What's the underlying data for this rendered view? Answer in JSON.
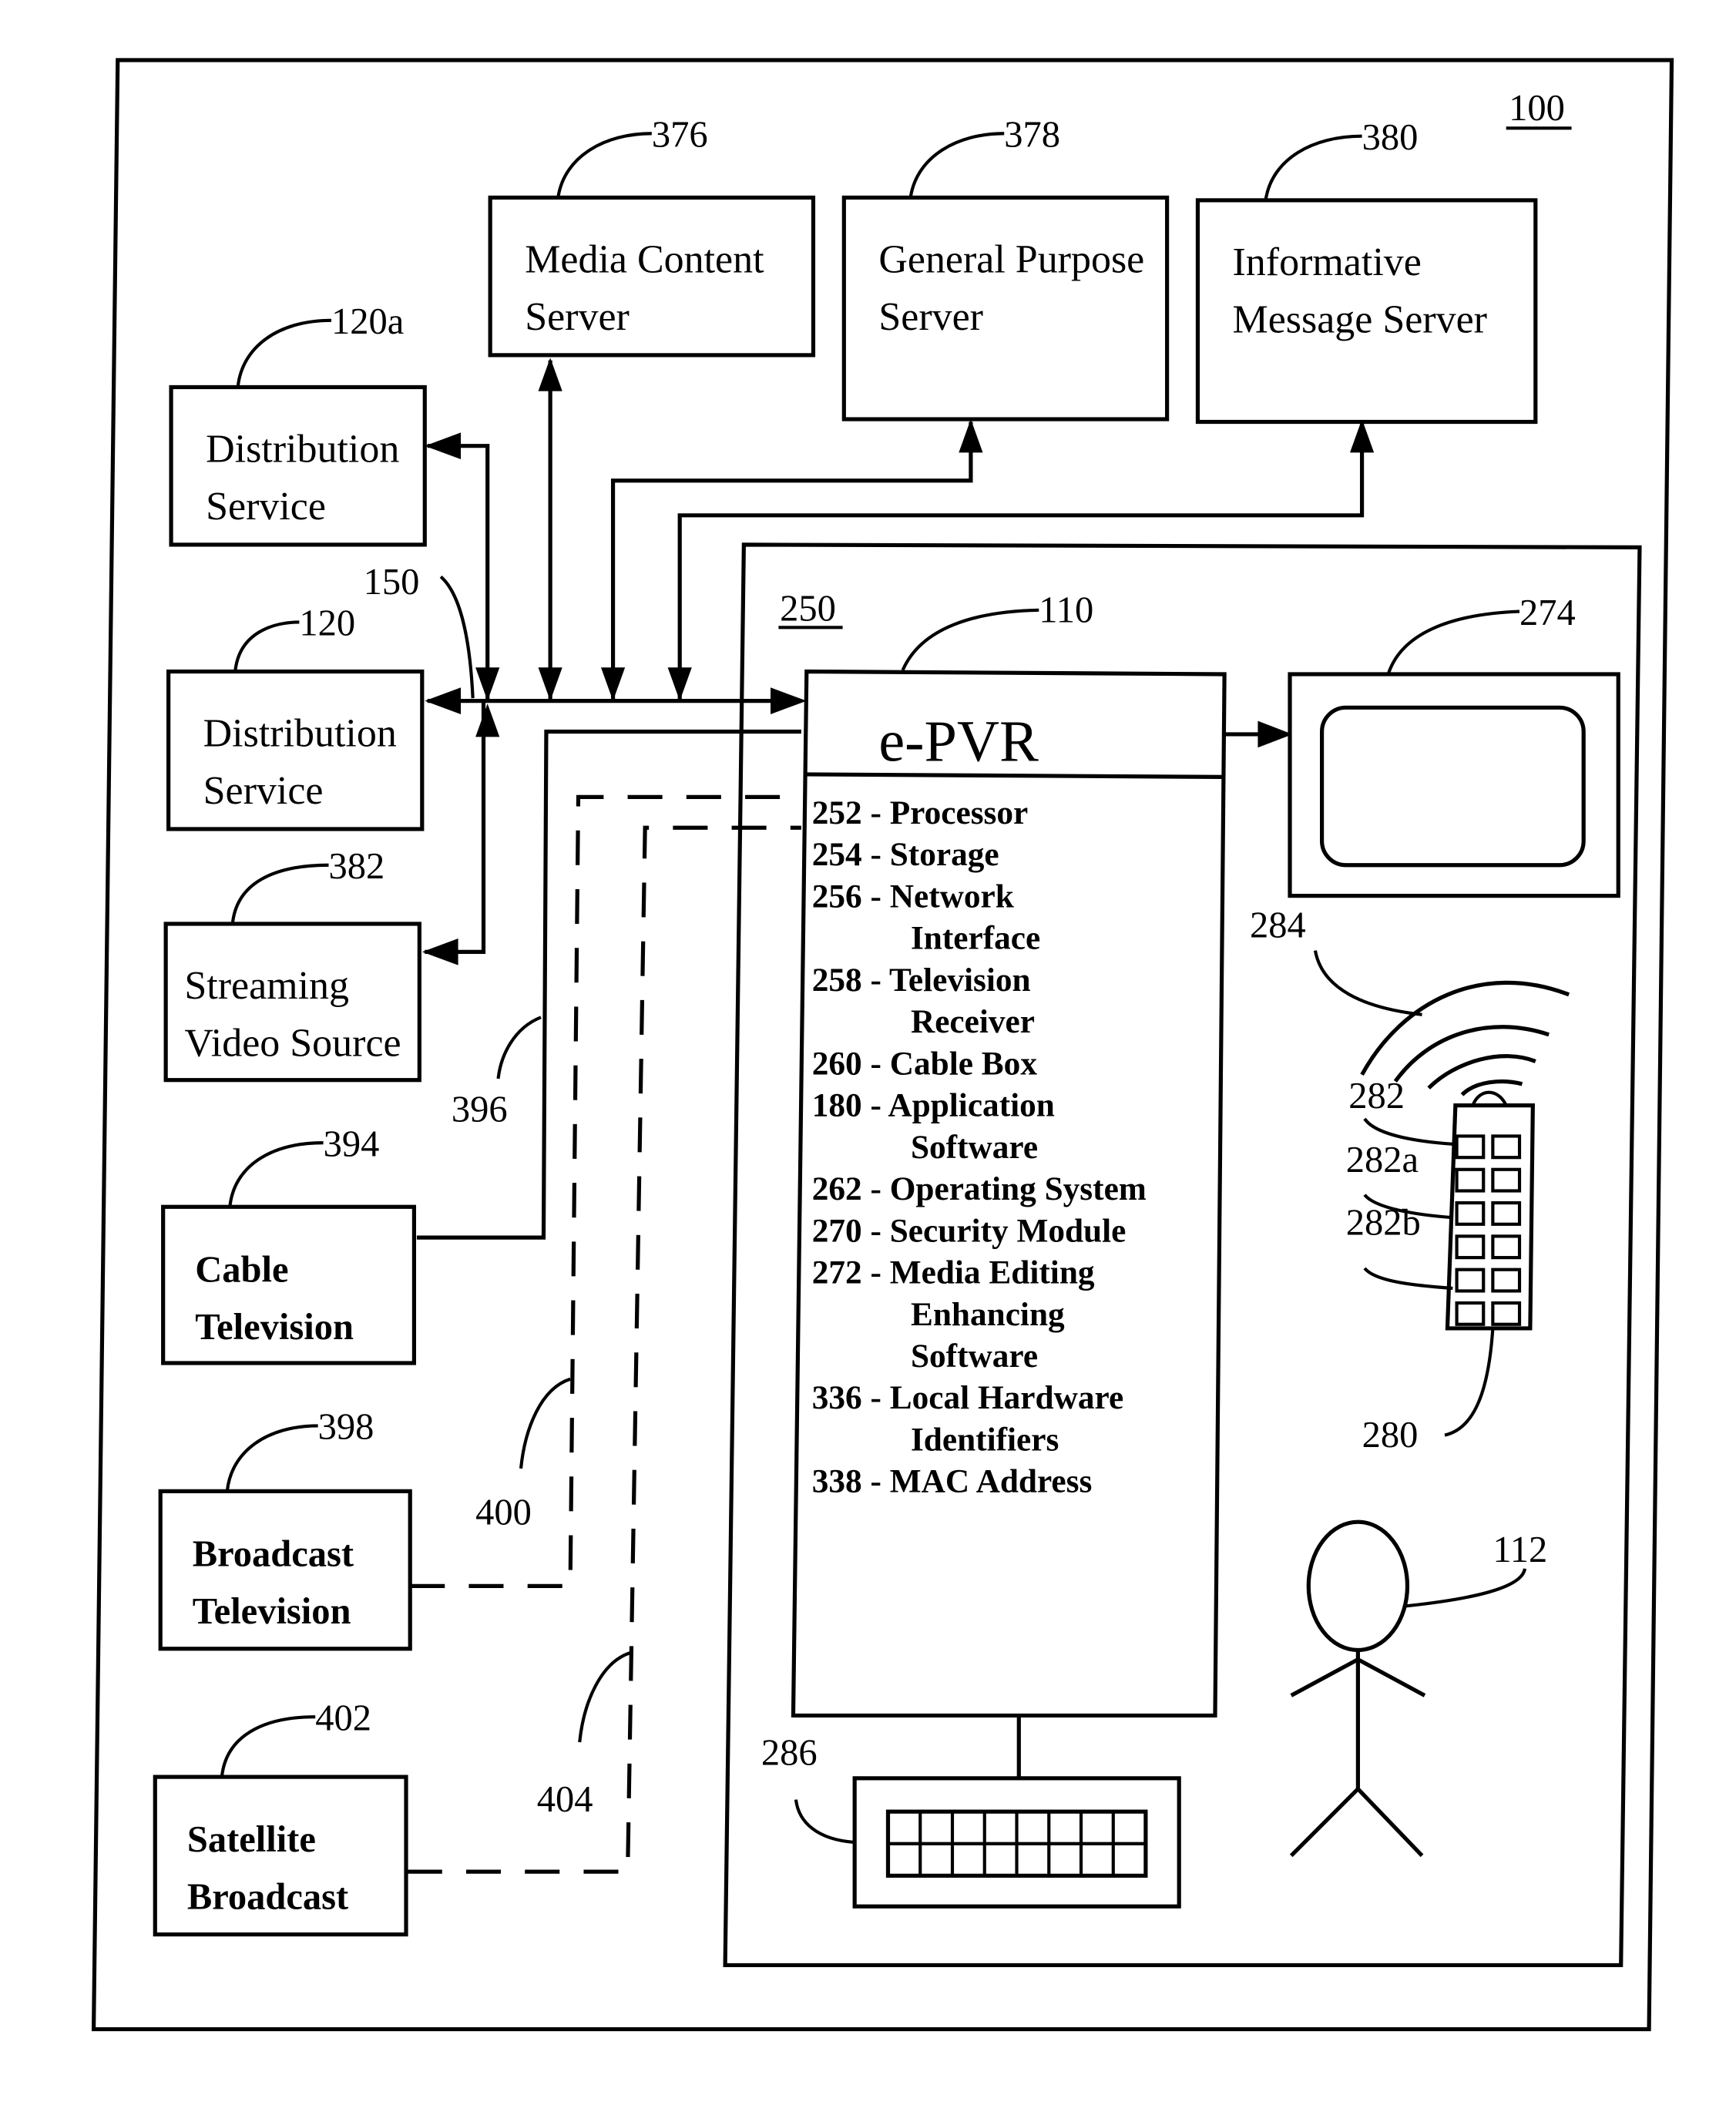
{
  "figure": {
    "system_ref": "100",
    "local_env_ref": "250",
    "network_ref": "150"
  },
  "servers": [
    {
      "ref": "376",
      "lines": [
        "Media Content",
        "Server"
      ]
    },
    {
      "ref": "378",
      "lines": [
        "General Purpose",
        "Server"
      ]
    },
    {
      "ref": "380",
      "lines": [
        "Informative",
        "Message Server"
      ]
    }
  ],
  "sources": [
    {
      "ref": "120a",
      "lines": [
        "Distribution",
        "Service"
      ]
    },
    {
      "ref": "120",
      "lines": [
        "Distribution",
        "Service"
      ]
    },
    {
      "ref": "382",
      "lines": [
        "Streaming",
        "Video Source"
      ]
    },
    {
      "ref": "394",
      "lines": [
        "Cable",
        "Television"
      ]
    },
    {
      "ref": "398",
      "lines": [
        "Broadcast",
        "Television"
      ]
    },
    {
      "ref": "402",
      "lines": [
        "Satellite",
        "Broadcast"
      ]
    }
  ],
  "links": {
    "cable_link_ref": "396",
    "broadcast_link_ref": "400",
    "satellite_link_ref": "404"
  },
  "epvr": {
    "ref": "110",
    "title": "e-PVR",
    "components": [
      "252 - Processor",
      "254 - Storage",
      "256 - Network",
      "Interface",
      "258 - Television",
      "Receiver",
      "260 - Cable Box",
      "180 - Application",
      "Software",
      "262 - Operating System",
      "270 - Security Module",
      "272 - Media Editing",
      "Enhancing",
      "Software",
      "336 - Local Hardware",
      "Identifiers",
      "338 - MAC Address"
    ]
  },
  "devices": {
    "television_ref": "274",
    "signal_ref": "284",
    "remote_ref": "280",
    "remote_buttons_ref": "282",
    "remote_button_a_ref": "282a",
    "remote_button_b_ref": "282b",
    "keyboard_ref": "286",
    "user_ref": "112"
  }
}
